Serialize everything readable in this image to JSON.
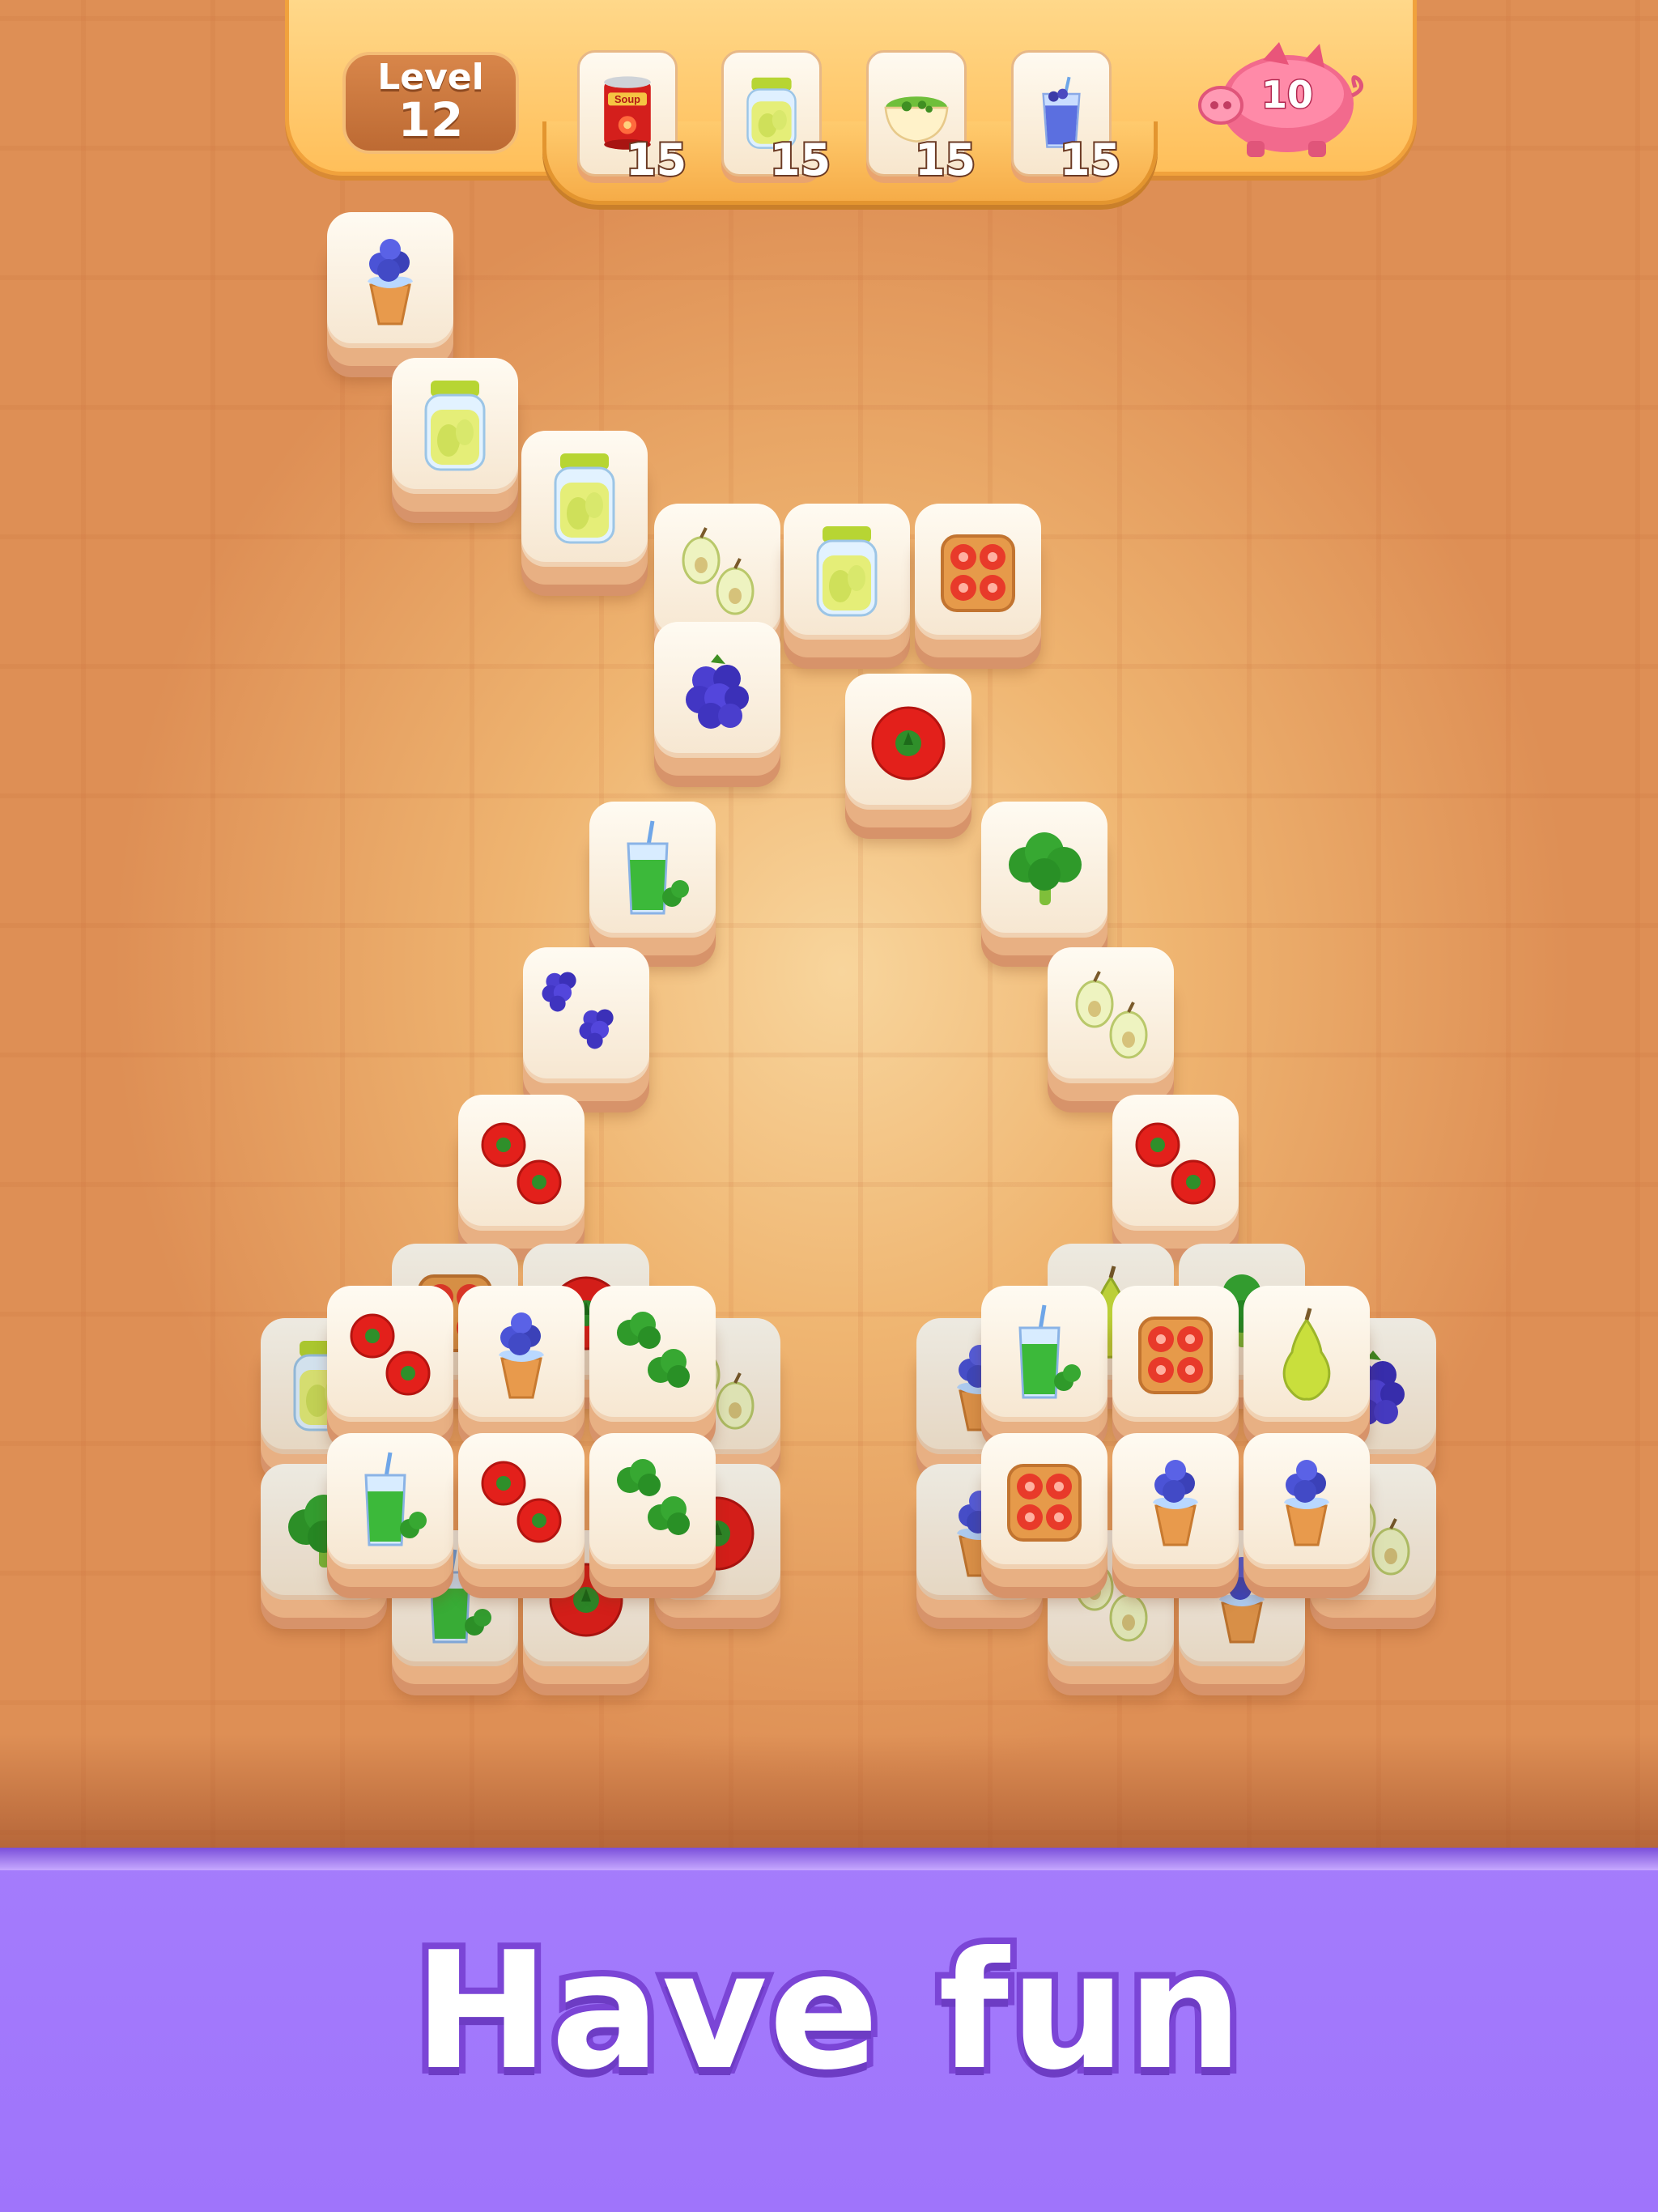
{
  "hud": {
    "level_label": "Level",
    "level_number": "12",
    "goals": [
      {
        "icon": "soup-can-icon",
        "label": "Soup",
        "count": "15"
      },
      {
        "icon": "pear-jar-icon",
        "count": "15"
      },
      {
        "icon": "broccoli-soup-bowl-icon",
        "count": "15"
      },
      {
        "icon": "blueberry-juice-icon",
        "count": "15"
      }
    ],
    "piggy_bank": {
      "icon": "piggy-bank-icon",
      "count": "10"
    }
  },
  "tile_types": {
    "berry-icecream": "blueberry-ice-cream-icon",
    "pear-jar": "pear-jar-icon",
    "pears": "pears-icon",
    "pear": "pear-icon",
    "tomato-toast": "tomato-toast-icon",
    "blackberry": "blackberry-icon",
    "blackberries": "blackberries-icon",
    "tomato": "tomato-icon",
    "tomatoes": "tomatoes-icon",
    "broccoli": "broccoli-icon",
    "broccolis": "broccolis-icon",
    "green-juice": "green-juice-icon"
  },
  "colors": {
    "footer": "#a47cfc",
    "hud": "#ffc86e",
    "tile_face": "#fff8ea",
    "tile_side": "#e8b083"
  },
  "footer": {
    "tagline": "Have fun"
  }
}
